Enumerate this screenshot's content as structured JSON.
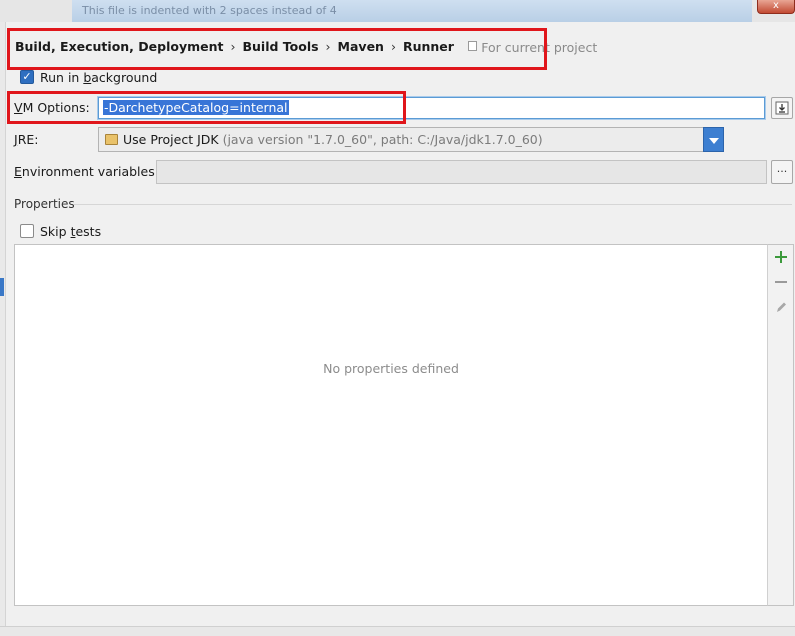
{
  "window": {
    "tooltip_text": "This file is indented with 2 spaces instead of 4",
    "close_label": "x"
  },
  "breadcrumb": {
    "items": [
      "Build, Execution, Deployment",
      "Build Tools",
      "Maven",
      "Runner"
    ],
    "separator": "›",
    "scope_label": "For current project"
  },
  "run_in_background": {
    "label_pre": "Run in ",
    "label_mnemonic": "b",
    "label_post": "ackground",
    "checked": true
  },
  "vm_options": {
    "label_mnemonic": "V",
    "label_rest": "M Options:",
    "value": "-DarchetypeCatalog=internal"
  },
  "jre": {
    "label_mnemonic": "J",
    "label_rest": "RE:",
    "value": "Use Project JDK",
    "detail": "(java version \"1.7.0_60\", path: C:/Java/jdk1.7.0_60)"
  },
  "env_vars": {
    "label_mnemonic": "E",
    "label_rest": "nvironment variables:",
    "browse_label": "..."
  },
  "properties": {
    "section_title": "Properties",
    "empty_text": "No properties defined"
  },
  "skip_tests": {
    "label_pre": "Skip ",
    "label_mnemonic": "t",
    "label_post": "ests",
    "checked": false
  },
  "colors": {
    "highlight_red": "#e0161b",
    "selection_blue": "#3875d7",
    "add_green": "#3c9a3c"
  },
  "icons": {
    "add": "plus-icon",
    "remove": "minus-icon",
    "edit": "pencil-icon",
    "expand": "expand-field-icon",
    "jdk": "jdk-folder-icon"
  }
}
